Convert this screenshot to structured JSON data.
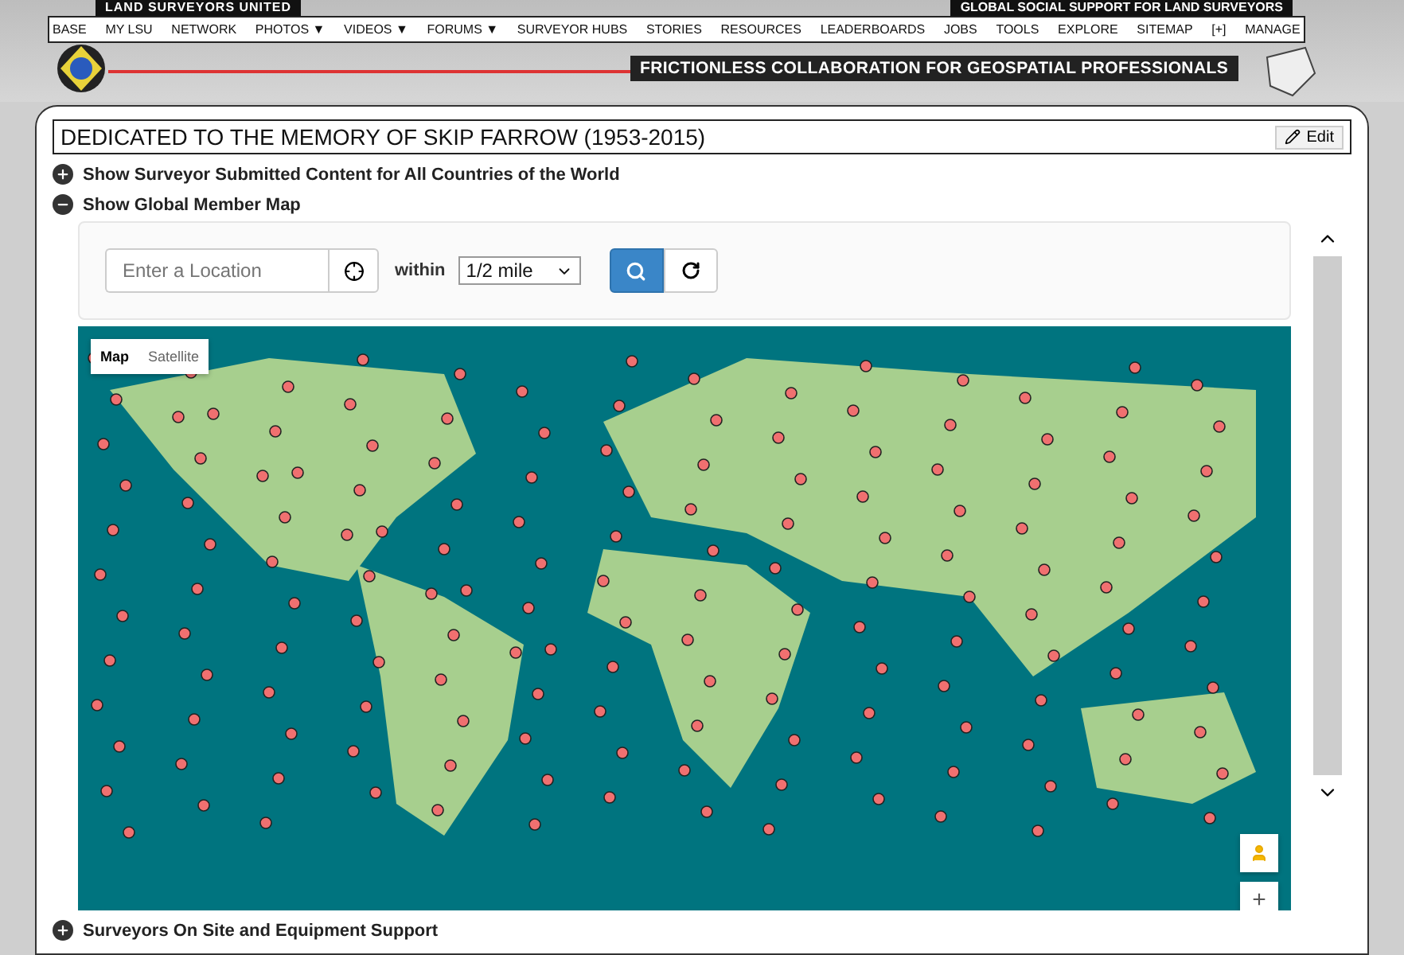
{
  "banner": {
    "site_title": "LAND SURVEYORS UNITED",
    "slogan": "GLOBAL SOCIAL SUPPORT FOR LAND SURVEYORS",
    "tagline": "FRICTIONLESS COLLABORATION FOR GEOSPATIAL PROFESSIONALS"
  },
  "nav": [
    "BASE",
    "MY LSU",
    "NETWORK",
    "PHOTOS ▼",
    "VIDEOS ▼",
    "FORUMS ▼",
    "SURVEYOR HUBS",
    "STORIES",
    "RESOURCES",
    "LEADERBOARDS",
    "JOBS",
    "TOOLS",
    "EXPLORE",
    "SITEMAP",
    "[+]",
    "MANAGE"
  ],
  "panel": {
    "title": "DEDICATED TO THE MEMORY OF SKIP FARROW (1953-2015)",
    "edit_button": "Edit"
  },
  "sections": [
    {
      "label": "Show Surveyor Submitted Content for All Countries of the World",
      "expanded": false
    },
    {
      "label": "Show Global Member Map",
      "expanded": true
    },
    {
      "label": "Surveyors On Site and Equipment Support",
      "expanded": false
    }
  ],
  "search": {
    "placeholder": "Enter a Location",
    "within_label": "within",
    "radius": "1/2 mile"
  },
  "map": {
    "types": [
      {
        "label": "Map",
        "selected": true
      },
      {
        "label": "Satellite",
        "selected": false
      }
    ],
    "zoom_in": "+"
  }
}
